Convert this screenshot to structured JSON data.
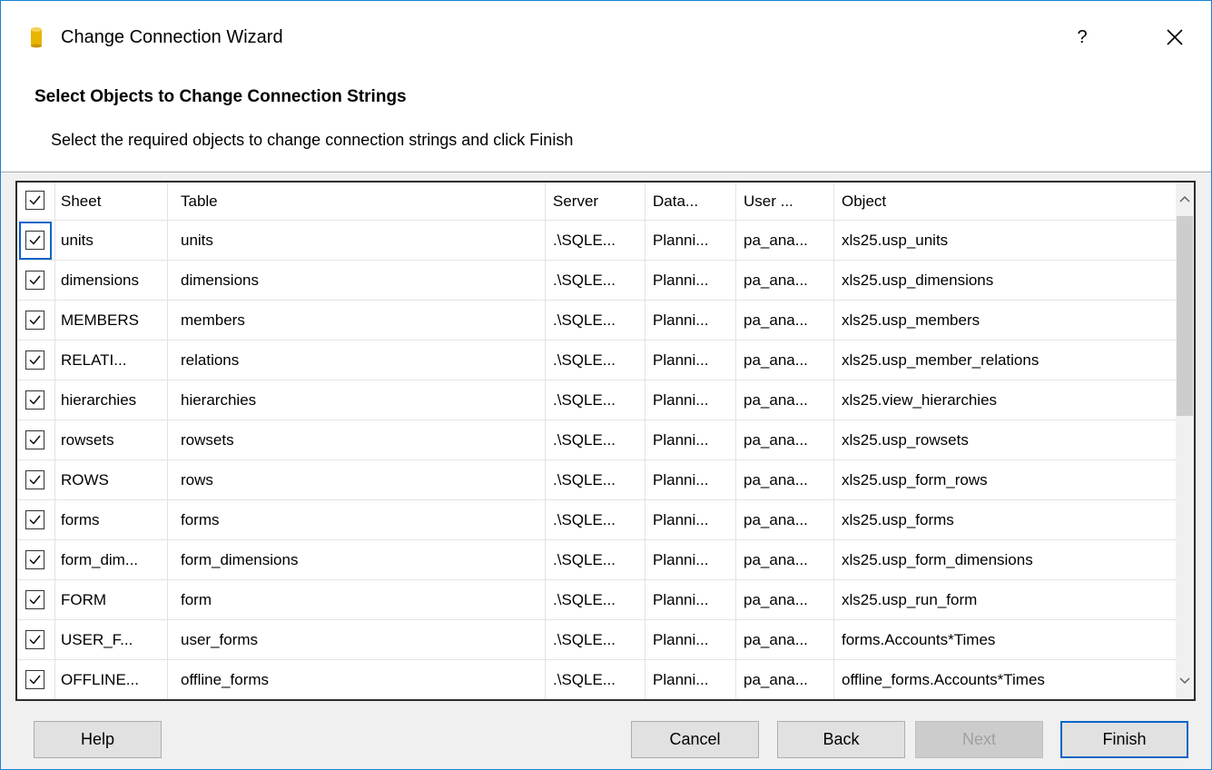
{
  "window": {
    "title": "Change Connection Wizard",
    "help_label": "?"
  },
  "header": {
    "title": "Select Objects to Change Connection Strings",
    "subtitle": "Select the required objects to change connection strings and click Finish"
  },
  "grid": {
    "header_checked": true,
    "columns": [
      "Sheet",
      "Table",
      "Server",
      "Data...",
      "User ...",
      "Object"
    ],
    "rows": [
      {
        "checked": true,
        "sheet": "units",
        "table": "units",
        "server": ".\\SQLE...",
        "database": "Planni...",
        "user": "pa_ana...",
        "object": "xls25.usp_units"
      },
      {
        "checked": true,
        "sheet": "dimensions",
        "table": "dimensions",
        "server": ".\\SQLE...",
        "database": "Planni...",
        "user": "pa_ana...",
        "object": "xls25.usp_dimensions"
      },
      {
        "checked": true,
        "sheet": "MEMBERS",
        "table": "members",
        "server": ".\\SQLE...",
        "database": "Planni...",
        "user": "pa_ana...",
        "object": "xls25.usp_members"
      },
      {
        "checked": true,
        "sheet": "RELATI...",
        "table": "relations",
        "server": ".\\SQLE...",
        "database": "Planni...",
        "user": "pa_ana...",
        "object": "xls25.usp_member_relations"
      },
      {
        "checked": true,
        "sheet": "hierarchies",
        "table": "hierarchies",
        "server": ".\\SQLE...",
        "database": "Planni...",
        "user": "pa_ana...",
        "object": "xls25.view_hierarchies"
      },
      {
        "checked": true,
        "sheet": "rowsets",
        "table": "rowsets",
        "server": ".\\SQLE...",
        "database": "Planni...",
        "user": "pa_ana...",
        "object": "xls25.usp_rowsets"
      },
      {
        "checked": true,
        "sheet": "ROWS",
        "table": "rows",
        "server": ".\\SQLE...",
        "database": "Planni...",
        "user": "pa_ana...",
        "object": "xls25.usp_form_rows"
      },
      {
        "checked": true,
        "sheet": "forms",
        "table": "forms",
        "server": ".\\SQLE...",
        "database": "Planni...",
        "user": "pa_ana...",
        "object": "xls25.usp_forms"
      },
      {
        "checked": true,
        "sheet": "form_dim...",
        "table": "form_dimensions",
        "server": ".\\SQLE...",
        "database": "Planni...",
        "user": "pa_ana...",
        "object": "xls25.usp_form_dimensions"
      },
      {
        "checked": true,
        "sheet": "FORM",
        "table": "form",
        "server": ".\\SQLE...",
        "database": "Planni...",
        "user": "pa_ana...",
        "object": "xls25.usp_run_form"
      },
      {
        "checked": true,
        "sheet": "USER_F...",
        "table": "user_forms",
        "server": ".\\SQLE...",
        "database": "Planni...",
        "user": "pa_ana...",
        "object": "forms.Accounts*Times"
      },
      {
        "checked": true,
        "sheet": "OFFLINE...",
        "table": "offline_forms",
        "server": ".\\SQLE...",
        "database": "Planni...",
        "user": "pa_ana...",
        "object": "offline_forms.Accounts*Times"
      }
    ]
  },
  "buttons": {
    "help": "Help",
    "cancel": "Cancel",
    "back": "Back",
    "next": "Next",
    "finish": "Finish"
  },
  "colors": {
    "accent": "#0a64c8",
    "window_border": "#1883d7",
    "icon_gold": "#e8b400"
  }
}
